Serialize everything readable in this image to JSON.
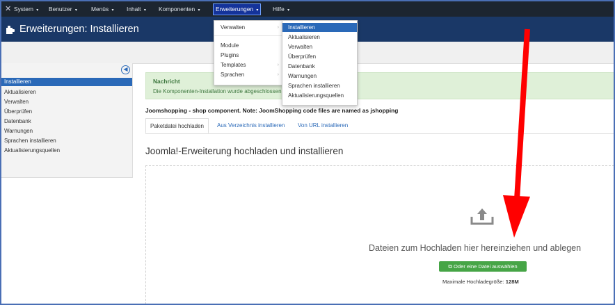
{
  "navbar": {
    "logo": "✕",
    "items": [
      {
        "label": "System"
      },
      {
        "label": "Benutzer"
      },
      {
        "label": "Menüs"
      },
      {
        "label": "Inhalt"
      },
      {
        "label": "Komponenten"
      },
      {
        "label": "Erweiterungen"
      },
      {
        "label": "Hilfe"
      }
    ],
    "caret": "▾"
  },
  "subhead": {
    "title": "Erweiterungen: Installieren"
  },
  "sidebar": {
    "toggle": "◀",
    "items": [
      {
        "label": "Installieren"
      },
      {
        "label": "Aktualisieren"
      },
      {
        "label": "Verwalten"
      },
      {
        "label": "Überprüfen"
      },
      {
        "label": "Datenbank"
      },
      {
        "label": "Warnungen"
      },
      {
        "label": "Sprachen installieren"
      },
      {
        "label": "Aktualisierungsquellen"
      }
    ]
  },
  "message": {
    "title": "Nachricht",
    "text": "Die Komponenten-Installation wurde abgeschlossen!"
  },
  "note": "Joomshopping - shop component. Note: JoomShopping code files are named as jshopping",
  "tabs": [
    {
      "label": "Paketdatei hochladen"
    },
    {
      "label": "Aus Verzeichnis installieren"
    },
    {
      "label": "Von URL installieren"
    }
  ],
  "section_title": "Joomla!-Erweiterung hochladen und installieren",
  "dropzone": {
    "text": "Dateien zum Hochladen hier hereinziehen und ablegen",
    "button": "Oder eine Datei auswählen",
    "max_label": "Maximale Hochladegröße:",
    "max_value": "128M"
  },
  "menu_erweiterungen": {
    "items": [
      {
        "label": "Verwalten"
      },
      {
        "label": "Module"
      },
      {
        "label": "Plugins"
      },
      {
        "label": "Templates"
      },
      {
        "label": "Sprachen"
      }
    ],
    "sub_arrow": "›"
  },
  "menu_verwalten": {
    "items": [
      {
        "label": "Installieren"
      },
      {
        "label": "Aktualisieren"
      },
      {
        "label": "Verwalten"
      },
      {
        "label": "Überprüfen"
      },
      {
        "label": "Datenbank"
      },
      {
        "label": "Warnungen"
      },
      {
        "label": "Sprachen installieren"
      },
      {
        "label": "Aktualisierungsquellen"
      }
    ]
  },
  "colors": {
    "navbar": "#1c2530",
    "subhead": "#1a3867",
    "accent": "#2a69b8",
    "success": "#46a546",
    "arrow": "#ff0000"
  }
}
